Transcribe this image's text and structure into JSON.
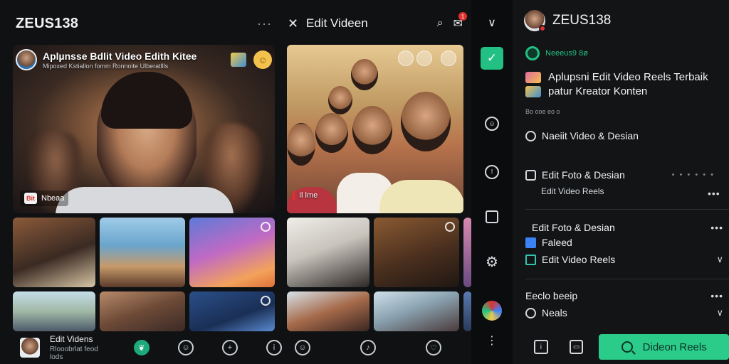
{
  "left": {
    "brand": "ZEUS138",
    "more_glyph": "···",
    "hero": {
      "title": "Aplµnsse Bdlit Video     Edith Kitee",
      "subtitle": "Mipoxed Kstiallon fomm Ronnoite Ulberatllls",
      "tag_icon": "Bit",
      "tag_label": "Nbeaa",
      "badge_glyph": "☺"
    },
    "bottom": {
      "title": "Edit Videns",
      "subtitle": "Rlooobrlat feod lods"
    }
  },
  "middle": {
    "close_glyph": "✕",
    "title": "Edit Videen",
    "notification_count": "1",
    "hero_tag": "Il lme"
  },
  "right": {
    "user": "ZEUS138",
    "status": "Neeeus9 8ø",
    "promo_line1": "Aplupsni Edit Video Reels Terbaik",
    "promo_line2": "patur Kreator Konten",
    "small_caption": "Bo ooe eo o",
    "items": [
      {
        "label": "Naeiit Video & Desian"
      },
      {
        "label": "Edit Foto & Desian",
        "sub": "Edit Video Reels",
        "dash": "• • • • • •"
      },
      {
        "label": "Edit Foto & Desian"
      },
      {
        "label": "Faleed"
      },
      {
        "label": "Edit Video Reels"
      },
      {
        "label": "Eeclo beeip"
      },
      {
        "label": "Neals"
      }
    ],
    "cta_label": "Dideon Reels"
  },
  "colors": {
    "accent_green": "#22c082",
    "cta_green": "#2bcc8a",
    "notif_red": "#e03131",
    "panel_bg": "#0f1113"
  }
}
